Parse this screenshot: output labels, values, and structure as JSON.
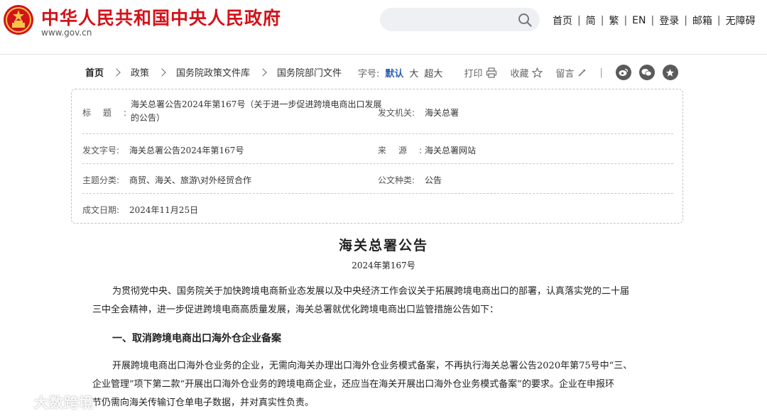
{
  "header": {
    "site_title": "中华人民共和国中央人民政府",
    "site_url": "www.gov.cn",
    "nav": [
      "首页",
      "简",
      "繁",
      "EN",
      "登录",
      "邮箱",
      "无障碍"
    ]
  },
  "breadcrumb": [
    "首页",
    "政策",
    "国务院政策文件库",
    "国务院部门文件"
  ],
  "tools": {
    "font_label": "字号:",
    "font_sizes": [
      "默认",
      "大",
      "超大"
    ],
    "print": "打印",
    "favorite": "收藏",
    "comment": "留言",
    "separator": "|",
    "share_icons": [
      "weibo-icon",
      "wechat-icon",
      "star-icon"
    ]
  },
  "info": {
    "title_label": "标题:",
    "title_value_line1": "海关总署公告2024年第167号（关于进一步促进跨境电商出口发展",
    "title_value_line2": "的公告）",
    "issuer_label": "发文机关:",
    "issuer_value": "海关总署",
    "doc_no_label": "发文字号:",
    "doc_no_value": "海关总署公告2024年第167号",
    "source_label": "来源:",
    "source_value": "海关总署网站",
    "category_label": "主题分类:",
    "category_value": "商贸、海关、旅游\\对外经贸合作",
    "type_label": "公文种类:",
    "type_value": "公告",
    "date_label": "成文日期:",
    "date_value": "2024年11月25日"
  },
  "article": {
    "title": "海关总署公告",
    "number": "2024年第167号",
    "para1_line1": "为贯彻党中央、国务院关于加快跨境电商新业态发展以及中央经济工作会议关于拓展跨境电商出口的部署，认真落实党的二十届",
    "para1_line2": "三中全会精神，进一步促进跨境电商高质量发展，海关总署就优化跨境电商出口监管措施公告如下：",
    "heading1": "一、取消跨境电商出口海外仓企业备案",
    "para2_line1": "开展跨境电商出口海外仓业务的企业，无需向海关办理出口海外仓业务模式备案，不再执行海关总署公告2020年第75号中“三、",
    "para2_line2": "企业管理”项下第二款“开展出口海外仓业务的跨境电商企业，还应当在海关开展出口海外仓业务模式备案”的要求。企业在申报环",
    "para2_line3": "节仍需向海关传输订仓单电子数据，并对真实性负责。"
  },
  "watermark": "大数跨境",
  "colors": {
    "brand_red": "#d4121a",
    "link_blue": "#2b5fb4"
  }
}
